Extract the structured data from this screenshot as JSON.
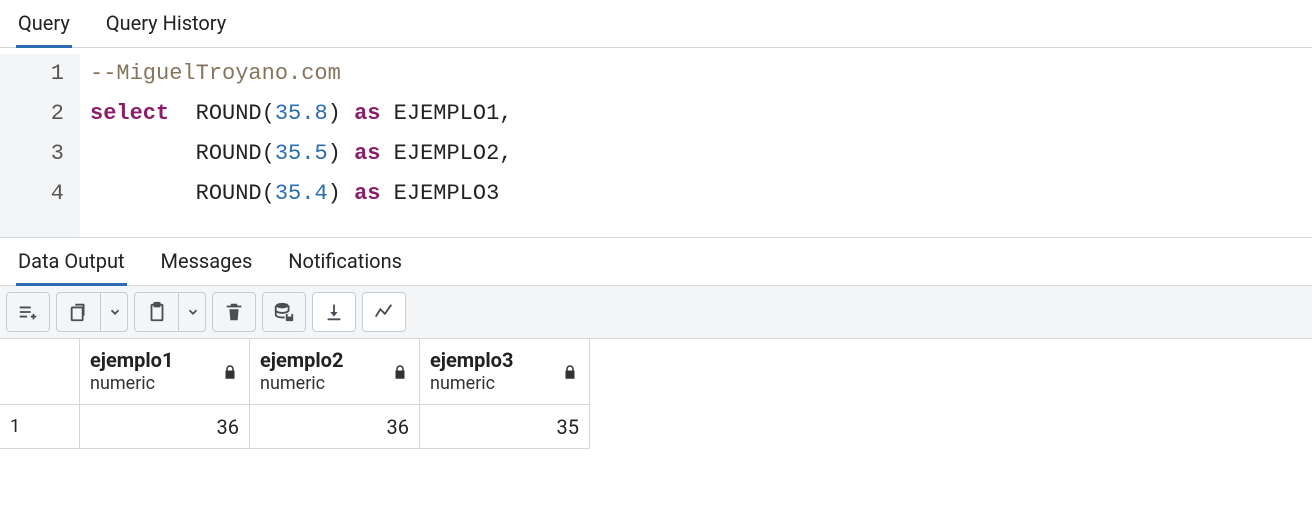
{
  "upper_tabs": {
    "query": "Query",
    "history": "Query History",
    "active": "query"
  },
  "editor": {
    "lines": [
      {
        "n": "1",
        "tokens": [
          {
            "cls": "tk-comment",
            "t": "--MiguelTroyano.com"
          }
        ]
      },
      {
        "n": "2",
        "tokens": [
          {
            "cls": "tk-keyword",
            "t": "select"
          },
          {
            "cls": "tk-plain",
            "t": "  "
          },
          {
            "cls": "tk-func",
            "t": "ROUND"
          },
          {
            "cls": "tk-paren",
            "t": "("
          },
          {
            "cls": "tk-number",
            "t": "35.8"
          },
          {
            "cls": "tk-paren",
            "t": ")"
          },
          {
            "cls": "tk-plain",
            "t": " "
          },
          {
            "cls": "tk-keyword",
            "t": "as"
          },
          {
            "cls": "tk-plain",
            "t": " EJEMPLO1,"
          }
        ]
      },
      {
        "n": "3",
        "tokens": [
          {
            "cls": "tk-plain",
            "t": "        "
          },
          {
            "cls": "tk-func",
            "t": "ROUND"
          },
          {
            "cls": "tk-paren",
            "t": "("
          },
          {
            "cls": "tk-number",
            "t": "35.5"
          },
          {
            "cls": "tk-paren",
            "t": ")"
          },
          {
            "cls": "tk-plain",
            "t": " "
          },
          {
            "cls": "tk-keyword",
            "t": "as"
          },
          {
            "cls": "tk-plain",
            "t": " EJEMPLO2,"
          }
        ]
      },
      {
        "n": "4",
        "tokens": [
          {
            "cls": "tk-plain",
            "t": "        "
          },
          {
            "cls": "tk-func",
            "t": "ROUND"
          },
          {
            "cls": "tk-paren",
            "t": "("
          },
          {
            "cls": "tk-number",
            "t": "35.4"
          },
          {
            "cls": "tk-paren",
            "t": ")"
          },
          {
            "cls": "tk-plain",
            "t": " "
          },
          {
            "cls": "tk-keyword",
            "t": "as"
          },
          {
            "cls": "tk-plain",
            "t": " EJEMPLO3"
          }
        ]
      }
    ]
  },
  "lower_tabs": {
    "data_output": "Data Output",
    "messages": "Messages",
    "notifications": "Notifications",
    "active": "data_output"
  },
  "result": {
    "columns": [
      {
        "name": "ejemplo1",
        "type": "numeric"
      },
      {
        "name": "ejemplo2",
        "type": "numeric"
      },
      {
        "name": "ejemplo3",
        "type": "numeric"
      }
    ],
    "rows": [
      {
        "n": "1",
        "v": [
          "36",
          "36",
          "35"
        ]
      }
    ]
  }
}
